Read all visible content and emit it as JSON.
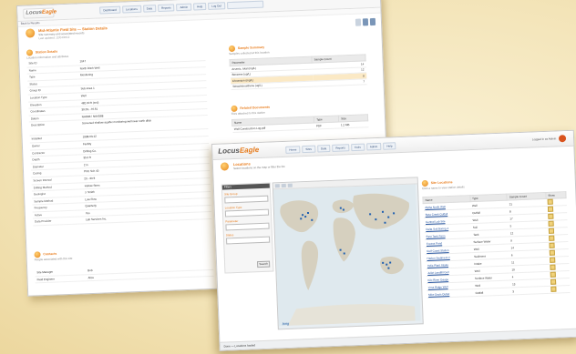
{
  "back": {
    "logo": {
      "a": "Locus",
      "b": "Eagle"
    },
    "nav": [
      "Dashboard",
      "Locations",
      "Data",
      "Reports",
      "Admin",
      "Help",
      "Log Out"
    ],
    "breadcrumb": "Back to Results",
    "header": {
      "title": "Mid-Atlantic Field Site — Station Details",
      "sub": "Site summary and associated records",
      "sub2": "Last updated: 12/04/2012"
    },
    "details_title": "Station Details",
    "details_sub": "Location information and attributes",
    "details": [
      [
        "Site ID",
        "1047"
      ],
      [
        "Name",
        "North Ditch Well"
      ],
      [
        "Type",
        "Monitoring"
      ],
      [
        "Status",
        ""
      ],
      [
        "Group ID",
        "Sub-Area 1"
      ],
      [
        "Location Type",
        "Well"
      ],
      [
        "Elevation",
        "482.00 ft (msl)"
      ],
      [
        "Coordinates",
        "39.29, -76.61"
      ],
      [
        "Datum",
        "NAD83 / NAVD88"
      ],
      [
        "Description",
        "Screened shallow aquifer monitoring well near north ditch"
      ],
      [
        "Installed",
        "1998-03-12"
      ]
    ],
    "extra": [
      [
        "Owner",
        "Facility"
      ],
      [
        "Contractor",
        "Drilling Co."
      ],
      [
        "Depth",
        "35.0 ft"
      ],
      [
        "Diameter",
        "2 in"
      ],
      [
        "Casing",
        "PVC Sch 40"
      ],
      [
        "Screen Interval",
        "20 - 30 ft"
      ],
      [
        "Drilling Method",
        "Hollow Stem"
      ],
      [
        "Geologist",
        "J. Smith"
      ],
      [
        "Sample Method",
        "Low Flow"
      ],
      [
        "Frequency",
        "Quarterly"
      ],
      [
        "Active",
        "Yes"
      ],
      [
        "Data Provider",
        "Lab Services Inc."
      ]
    ],
    "contact_title": "Contacts",
    "contact_sub": "People associated with this site",
    "contacts": [
      [
        "Site Manager",
        "Bob"
      ],
      [
        "Field Engineer",
        "Alice"
      ]
    ],
    "rpanel1": {
      "title": "Sample Summary",
      "sub": "Samples collected at this location",
      "headers": [
        "Parameter",
        "Sample Count"
      ],
      "rows": [
        [
          "Arsenic, total (mg/L)",
          "14"
        ],
        [
          "Benzene (ug/L)",
          "12"
        ],
        [
          "Chromium (mg/L)",
          "9"
        ],
        [
          "Tetrachloroethene (ug/L)",
          "7"
        ]
      ]
    },
    "rpanel2": {
      "title": "Related Documents",
      "sub": "Files attached to this station",
      "headers": [
        "Name",
        "Type",
        "Size"
      ],
      "rows": [
        [
          "Well Construction Log.pdf",
          "PDF",
          "1.2 MB"
        ]
      ]
    }
  },
  "front": {
    "logo": {
      "a": "Locus",
      "b": "Eagle"
    },
    "nav": [
      "Home",
      "Sites",
      "Data",
      "Reports",
      "Tools",
      "Admin",
      "Help"
    ],
    "user": "Logged in as Admin",
    "header": {
      "title": "Locations",
      "sub": "Select locations on the map or filter the list"
    },
    "filters": {
      "title": "Filters",
      "labels": [
        "Site Group",
        "Location Type",
        "Parameter",
        "Status"
      ],
      "button": "Search"
    },
    "map_brand": "bing",
    "sites_title": "Site Locations",
    "sites_sub": "Click a name to view station details",
    "sites_headers": [
      "Name",
      "Type",
      "Sample Count",
      "Show"
    ],
    "sites": [
      [
        "Alpha North Well",
        "Well",
        "21"
      ],
      [
        "Beta Creek Outfall",
        "Outfall",
        "8"
      ],
      [
        "Central Lab Site",
        "Well",
        "17"
      ],
      [
        "Delta Soil Boring 4",
        "Soil",
        "5"
      ],
      [
        "East Tank Farm",
        "Tank",
        "12"
      ],
      [
        "Foxtrot Pond",
        "Surface Water",
        "9"
      ],
      [
        "Gulf Coast Station",
        "Well",
        "14"
      ],
      [
        "Harbor Sediment 2",
        "Sediment",
        "6"
      ],
      [
        "India Plant Intake",
        "Intake",
        "11"
      ],
      [
        "Juliet Landfill Cell",
        "Well",
        "19"
      ],
      [
        "Kilo River Gauge",
        "Surface Water",
        "4"
      ],
      [
        "Lima Ridge Well",
        "Well",
        "13"
      ],
      [
        "Mike Drain Outlet",
        "Outfall",
        "3"
      ]
    ],
    "status": "Done — Locations loaded"
  }
}
